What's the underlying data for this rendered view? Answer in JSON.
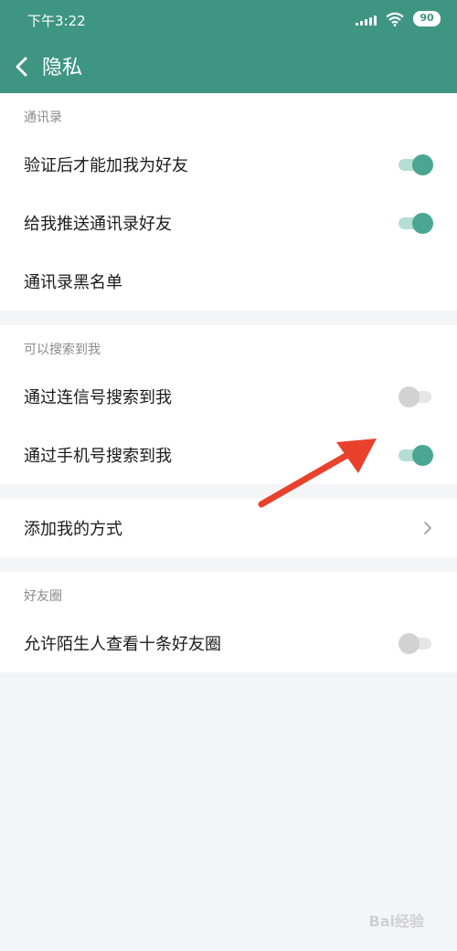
{
  "status_bar": {
    "time": "下午3:22",
    "battery": "90",
    "icons": [
      "signal-icon",
      "wifi-icon",
      "battery-icon"
    ]
  },
  "header": {
    "title": "隐私",
    "back_icon": "chevron-left-icon"
  },
  "sections": [
    {
      "header": "通讯录",
      "rows": [
        {
          "label": "验证后才能加我为好友",
          "toggle": true
        },
        {
          "label": "给我推送通讯录好友",
          "toggle": true
        },
        {
          "label": "通讯录黑名单"
        }
      ]
    },
    {
      "header": "可以搜索到我",
      "rows": [
        {
          "label": "通过连信号搜索到我",
          "toggle": false
        },
        {
          "label": "通过手机号搜索到我",
          "toggle": true
        }
      ]
    },
    {
      "rows": [
        {
          "label": "添加我的方式",
          "icon": "chevron-right-icon"
        }
      ]
    },
    {
      "header": "好友圈",
      "rows": [
        {
          "label": "允许陌生人查看十条好友圈",
          "toggle": false
        }
      ]
    }
  ],
  "watermark": "Bai经验",
  "colors": {
    "header_bg": "#3e9682",
    "toggle_on": "#4aa592",
    "toggle_off": "#d2d2d2",
    "annotation_arrow": "#e8412c"
  }
}
